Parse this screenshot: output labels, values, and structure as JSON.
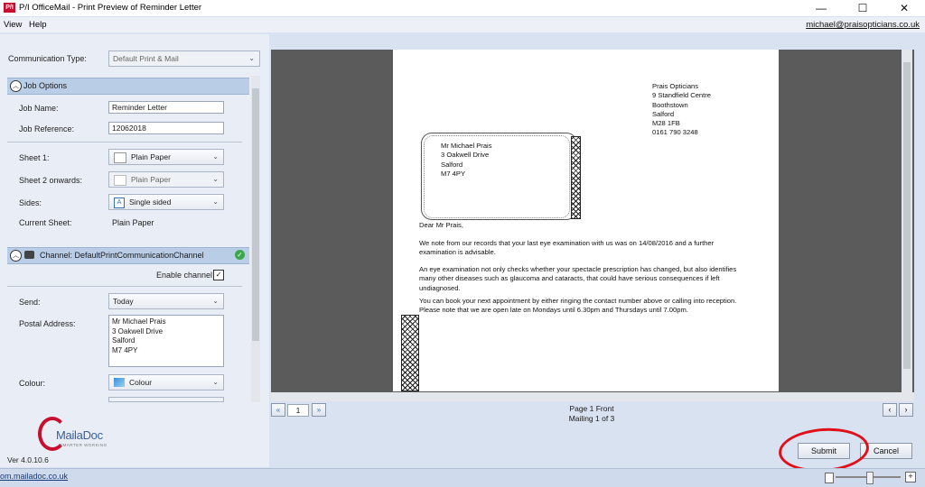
{
  "window": {
    "app_icon_text": "P/I",
    "title": "P/I OfficeMail - Print Preview of Reminder Letter",
    "minimize_glyph": "—",
    "maximize_glyph": "☐",
    "close_glyph": "✕"
  },
  "menu": {
    "items": [
      "View",
      "Help"
    ],
    "account_email": "michael@praisopticians.co.uk"
  },
  "communication": {
    "label": "Communication Type:",
    "value": "Default Print & Mail"
  },
  "job_options": {
    "header": "Job Options",
    "job_name_label": "Job Name:",
    "job_name": "Reminder Letter",
    "job_reference_label": "Job Reference:",
    "job_reference": "12062018",
    "sheet1_label": "Sheet 1:",
    "sheet1": "Plain Paper",
    "sheet2_label": "Sheet 2 onwards:",
    "sheet2": "Plain Paper",
    "sides_label": "Sides:",
    "sides": "Single sided",
    "current_sheet_label": "Current Sheet:",
    "current_sheet": "Plain Paper"
  },
  "channel": {
    "header": "Channel: DefaultPrintCommunicationChannel",
    "enable_label": "Enable channel",
    "enabled": true,
    "send_label": "Send:",
    "send": "Today",
    "postal_label": "Postal Address:",
    "postal_lines": [
      "Mr Michael Prais",
      "3 Oakwell Drive",
      "Salford",
      "M7 4PY"
    ],
    "colour_label": "Colour:",
    "colour": "Colour"
  },
  "letter": {
    "sender_lines": [
      "Prais Opticians",
      "9 Standfield Centre",
      "Boothstown",
      "Salford",
      "M28 1FB",
      "0161 790 3248"
    ],
    "recipient_lines": [
      "Mr Michael Prais",
      "3 Oakwell Drive",
      "Salford",
      "M7 4PY"
    ],
    "greeting": "Dear Mr Prais,",
    "paragraphs": [
      "We note from our records that your last eye examination with us was on 14/08/2016 and a further examination is advisable.",
      "An eye examination not only checks whether your spectacle prescription has changed, but also identifies many other diseases such as glaucoma and cataracts, that could have serious consequences if left undiagnosed.",
      "You can book your next appointment by either ringing the contact number above or calling into reception. Please note that we are open late on Mondays until 6.30pm and Thursdays until 7.00pm."
    ]
  },
  "navigation": {
    "page_number": "1",
    "page_info": "Page 1 Front",
    "mailing_info": "Mailing 1 of 3"
  },
  "branding": {
    "logo_text": "MailaDoc",
    "logo_tagline": "SMARTER WORKING",
    "version": "Ver 4.0.10.6",
    "website": "om.mailadoc.co.uk"
  },
  "actions": {
    "submit": "Submit",
    "cancel": "Cancel"
  },
  "colors": {
    "section_header": "#b9cde6",
    "preview_bg": "#5b5b5b",
    "highlight_ring": "#e0101a",
    "logo_red": "#c8102e"
  }
}
